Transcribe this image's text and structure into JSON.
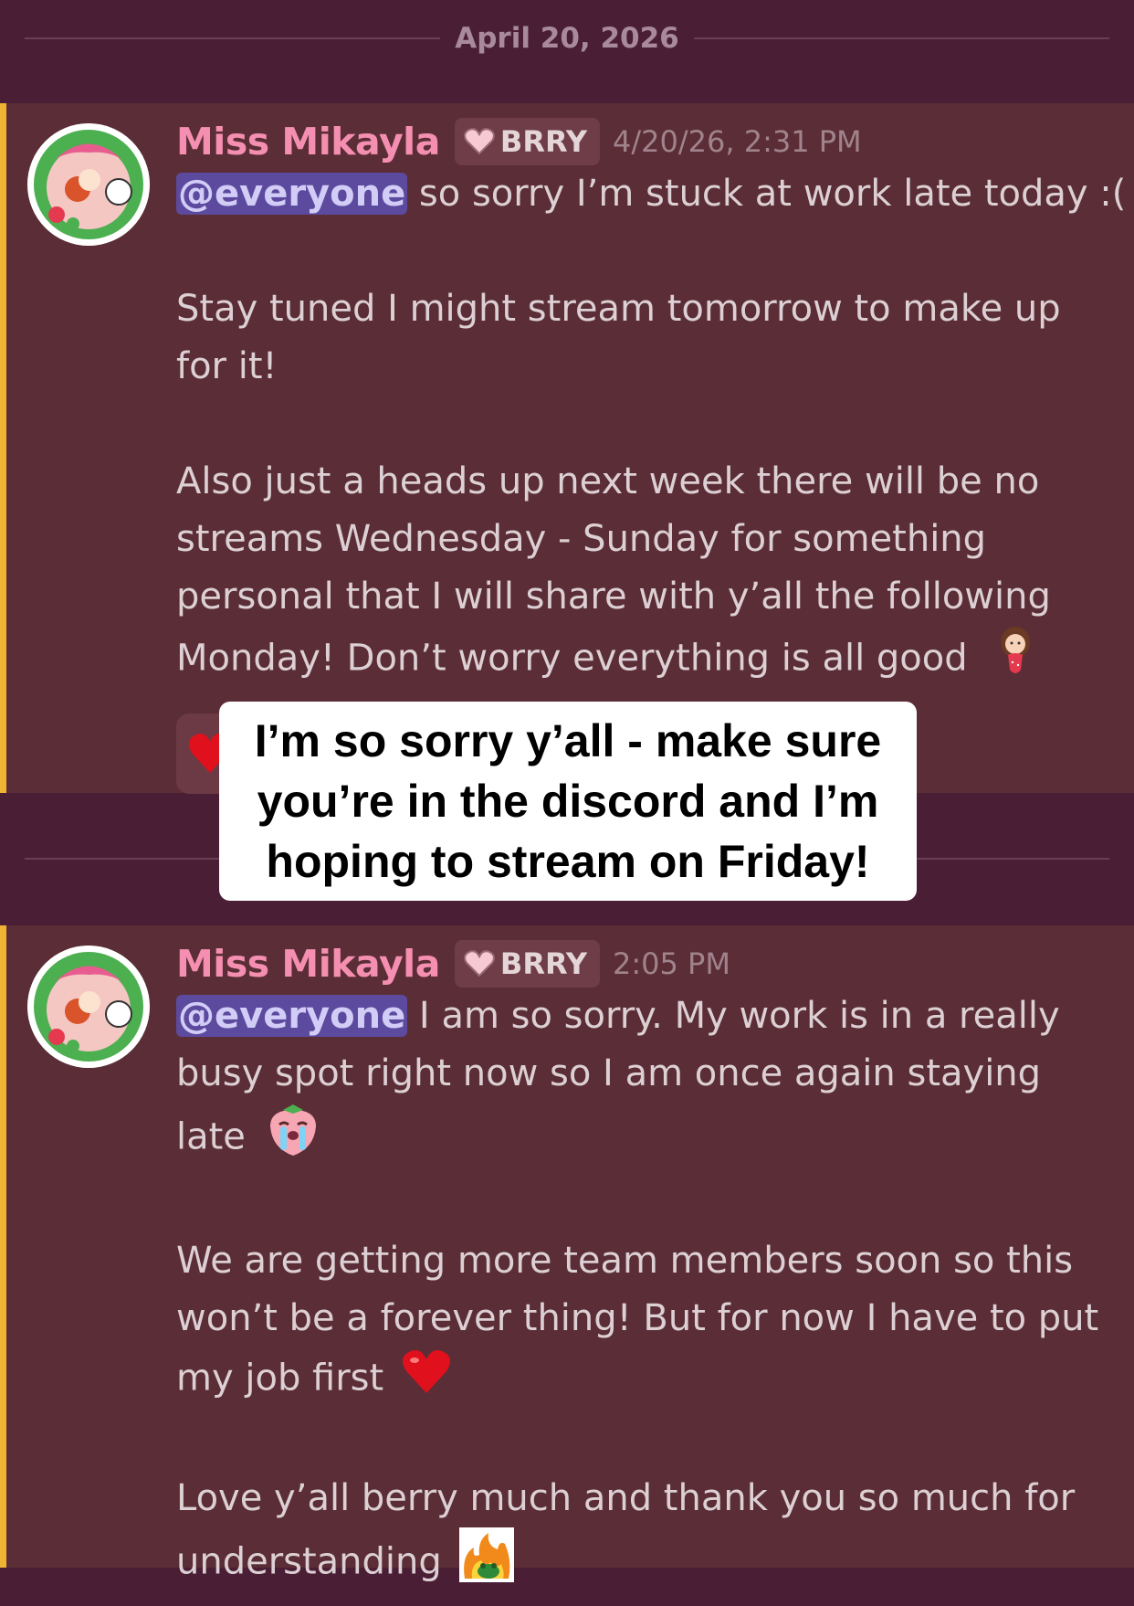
{
  "divider_top": {
    "date": "April 20, 2026"
  },
  "messages": [
    {
      "username": "Miss Mikayla",
      "tag": "BRRY",
      "timestamp": "4/20/26, 2:31 PM",
      "mention": "@everyone",
      "line1_rest": " so sorry I’m stuck at work late today :(",
      "para2": [
        "Stay tuned I might stream tomorrow to make up",
        "for it!"
      ],
      "para3": [
        "Also just a heads up next week there will be no",
        "streams Wednesday - Sunday for something",
        "personal that I will share with y’all the following",
        "Monday! Don’t worry everything is all good"
      ],
      "emojis": [
        "girl-with-strawberry-emoji"
      ]
    },
    {
      "username": "Miss Mikayla",
      "tag": "BRRY",
      "timestamp": "2:05 PM",
      "mention": "@everyone",
      "line1_rest": " I am so sorry. My work is in a really",
      "para1_rest": [
        "busy spot right now so I am once again staying",
        "late"
      ],
      "para2": [
        "We are getting more team members soon so this",
        "won’t be a forever thing! But for now I have to put",
        "my job first"
      ],
      "para3": [
        "Love y’all berry much and thank you so much for",
        "understanding"
      ],
      "emojis": [
        "crying-strawberry-emoji",
        "red-heart-emoji",
        "frog-fire-emoji"
      ]
    }
  ],
  "reaction": {
    "emoji": "red-heart-emoji"
  },
  "caption": {
    "text": "I’m so sorry y’all - make sure\nyou’re in the discord and I’m\nhoping to stream on Friday!"
  },
  "colors": {
    "background": "#4a1f35",
    "message_bg": "#5b2d36",
    "highlight_bar": "#f0b232",
    "username": "#f48fb1",
    "mention_bg": "#5c4a9e"
  }
}
